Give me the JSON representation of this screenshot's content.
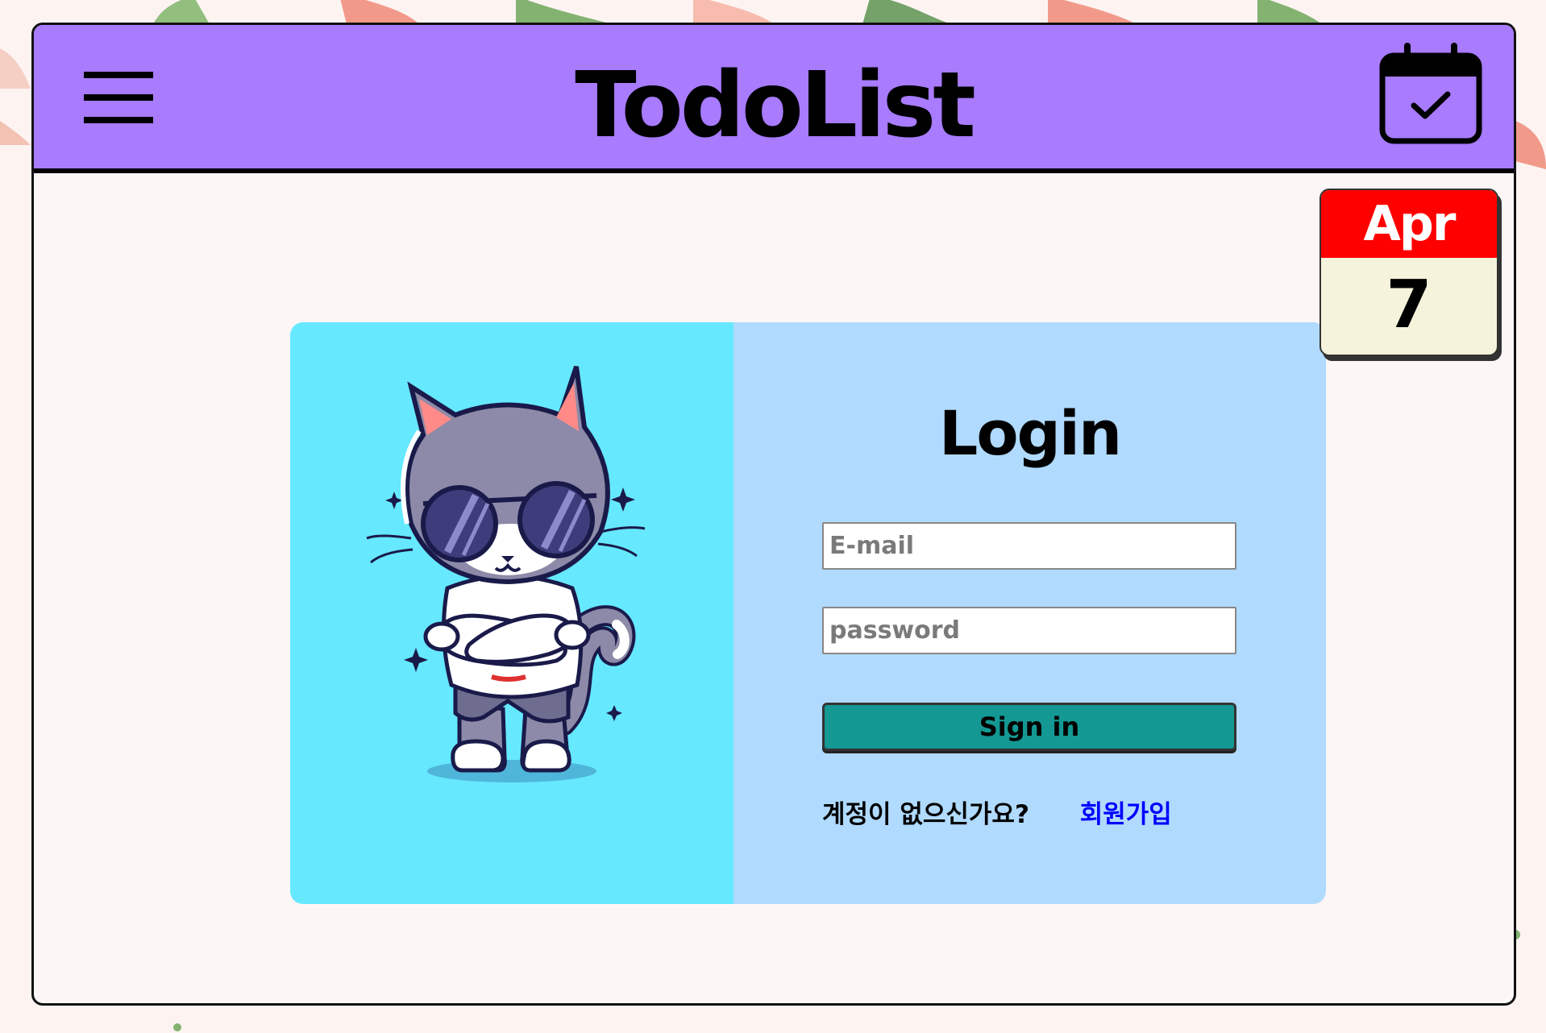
{
  "header": {
    "title": "TodoList",
    "menu_icon": "hamburger-menu-icon",
    "calendar_icon": "calendar-check-icon",
    "accent_color": "#a87bff"
  },
  "date_card": {
    "month": "Apr",
    "day": "7",
    "month_color": "#ff0000"
  },
  "login": {
    "title": "Login",
    "email_placeholder": "E-mail",
    "password_placeholder": "password",
    "signin_label": "Sign in",
    "signin_color": "#139893",
    "signup_prompt": "계정이 없으신가요?",
    "signup_link": "회원가입"
  },
  "illustration": {
    "icon": "cool-cat-with-sunglasses-icon"
  }
}
